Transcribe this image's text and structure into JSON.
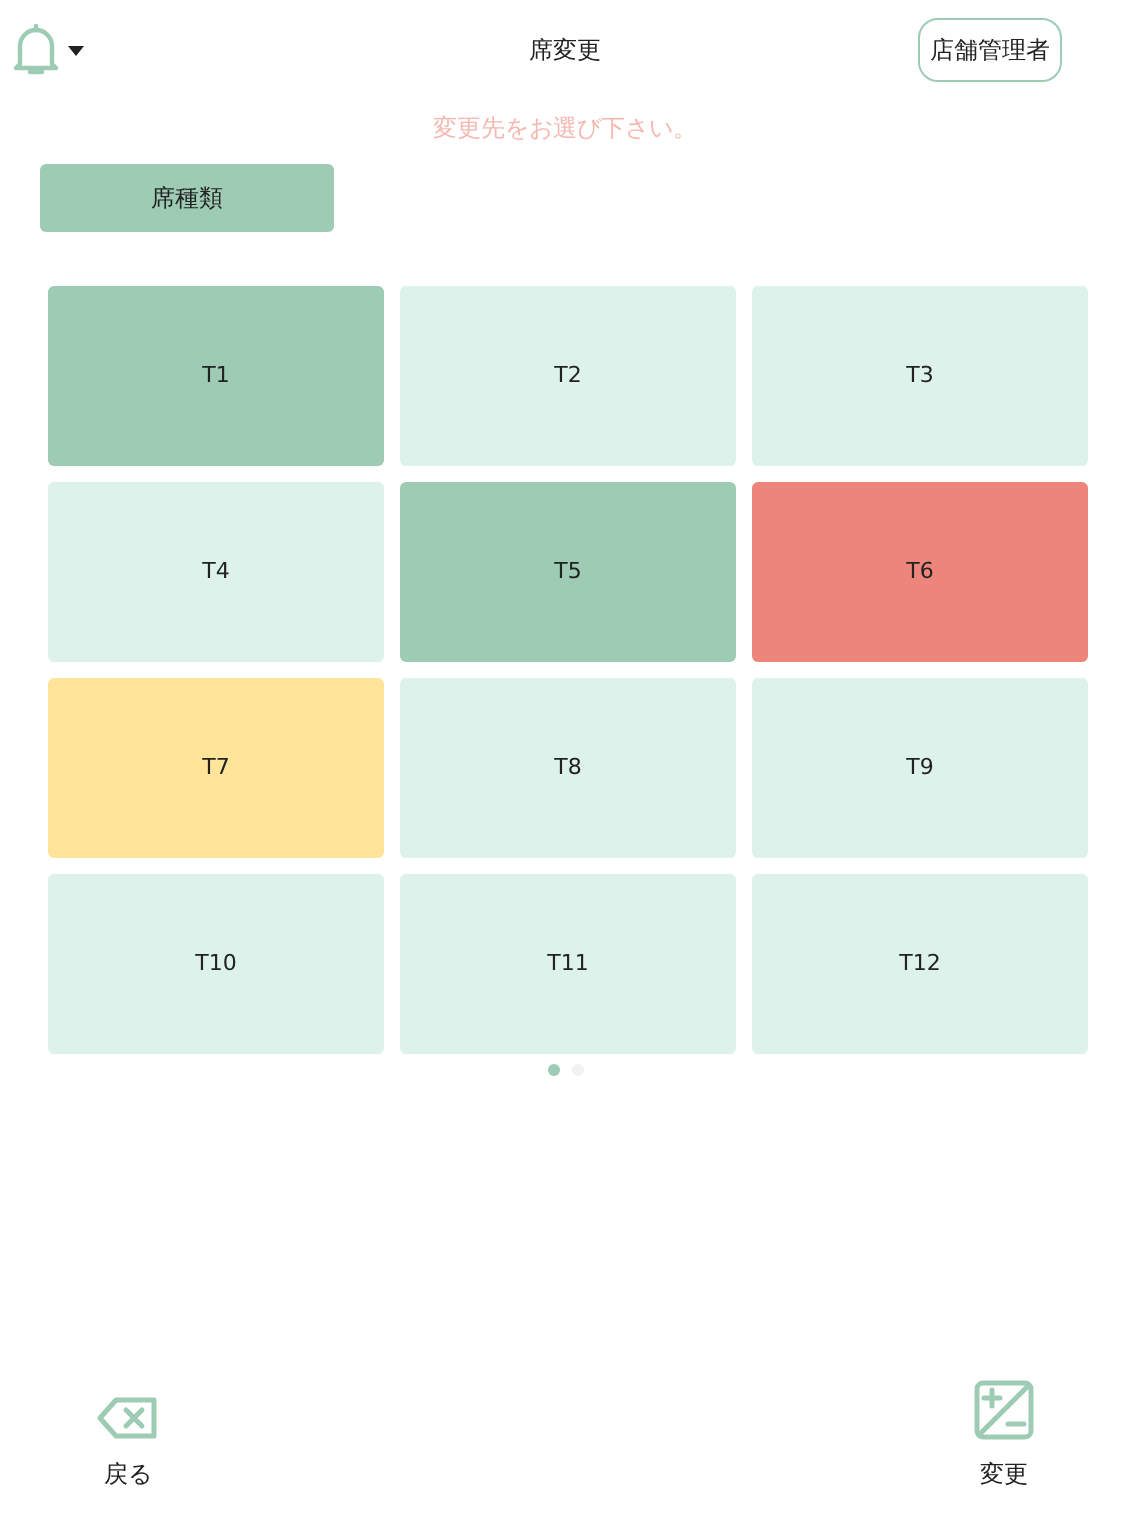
{
  "header": {
    "title": "席変更",
    "user_button": "店舗管理者"
  },
  "message": "変更先をお選び下さい。",
  "seat_type_button": "席種類",
  "tables": [
    {
      "label": "T1",
      "color": "#9dcbb4"
    },
    {
      "label": "T2",
      "color": "#ddf2ea"
    },
    {
      "label": "T3",
      "color": "#ddf2ea"
    },
    {
      "label": "T4",
      "color": "#ddf2ea"
    },
    {
      "label": "T5",
      "color": "#9dcbb4"
    },
    {
      "label": "T6",
      "color": "#ed857a"
    },
    {
      "label": "T7",
      "color": "#ffe499"
    },
    {
      "label": "T8",
      "color": "#ddf2ea"
    },
    {
      "label": "T9",
      "color": "#ddf2ea"
    },
    {
      "label": "T10",
      "color": "#ddf2ea"
    },
    {
      "label": "T11",
      "color": "#ddf2ea"
    },
    {
      "label": "T12",
      "color": "#ddf2ea"
    }
  ],
  "pages": [
    {
      "selected": true
    },
    {
      "selected": false
    }
  ],
  "footer": {
    "back": "戻る",
    "change": "変更"
  }
}
